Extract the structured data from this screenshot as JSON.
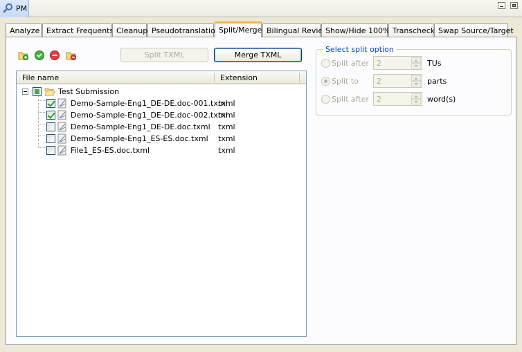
{
  "view": {
    "title": "PM"
  },
  "tabs": [
    {
      "label": "Analyze"
    },
    {
      "label": "Extract Frequents"
    },
    {
      "label": "Cleanup"
    },
    {
      "label": "Pseudotranslation"
    },
    {
      "label": "Split/Merge",
      "active": true
    },
    {
      "label": "Bilingual Review"
    },
    {
      "label": "Show/Hide 100%"
    },
    {
      "label": "Transcheck"
    },
    {
      "label": "Swap Source/Target"
    }
  ],
  "toolbar": {
    "icons": [
      "add-folder-icon",
      "check-all-icon",
      "remove-icon",
      "remove-folder-icon"
    ],
    "split_label": "Split TXML",
    "merge_label": "Merge TXML"
  },
  "table": {
    "columns": [
      "File name",
      "Extension"
    ],
    "root": {
      "name": "Test Submission",
      "state": "partial"
    },
    "files": [
      {
        "name": "Demo-Sample-Eng1_DE-DE.doc-001.txml",
        "ext": "txml",
        "checked": true
      },
      {
        "name": "Demo-Sample-Eng1_DE-DE.doc-002.txml",
        "ext": "txml",
        "checked": true
      },
      {
        "name": "Demo-Sample-Eng1_DE-DE.doc.txml",
        "ext": "txml",
        "checked": false
      },
      {
        "name": "Demo-Sample-Eng1_ES-ES.doc.txml",
        "ext": "txml",
        "checked": false
      },
      {
        "name": "File1_ES-ES.doc.txml",
        "ext": "txml",
        "checked": false
      }
    ]
  },
  "split_options": {
    "title": "Select split option",
    "options": [
      {
        "label": "Split after",
        "value": "2",
        "unit": "TUs",
        "selected": false
      },
      {
        "label": "Split to",
        "value": "2",
        "unit": "parts",
        "selected": true
      },
      {
        "label": "Split after",
        "value": "2",
        "unit": "word(s)",
        "selected": false
      }
    ]
  }
}
